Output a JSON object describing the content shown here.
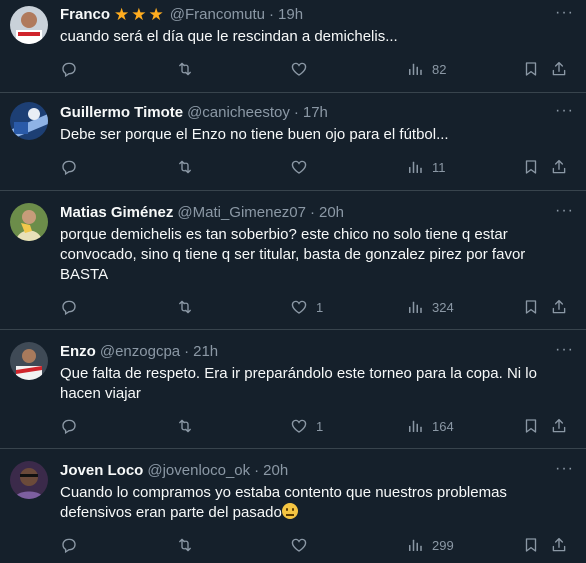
{
  "tweets": [
    {
      "name": "Franco",
      "stars": [
        "★",
        "★",
        "★"
      ],
      "handle": "@Francomutu",
      "dot": "·",
      "time": "19h",
      "text": "cuando será el día que le rescindan a demichelis...",
      "replies": "",
      "retweets": "",
      "likes": "",
      "views": "82",
      "more": "···"
    },
    {
      "name": "Guillermo Timote",
      "handle": "@canicheestoy",
      "dot": "·",
      "time": "17h",
      "text": "Debe ser porque el Enzo no tiene buen ojo para el fútbol...",
      "replies": "",
      "retweets": "",
      "likes": "",
      "views": "11",
      "more": "···"
    },
    {
      "name": "Matias Giménez",
      "handle": "@Mati_Gimenez07",
      "dot": "·",
      "time": "20h",
      "text": "porque demichelis es tan soberbio? este chico no solo tiene q estar convocado, sino q tiene q ser titular, basta de gonzalez pirez por favor BASTA",
      "replies": "",
      "retweets": "",
      "likes": "1",
      "views": "324",
      "more": "···"
    },
    {
      "name": "Enzo",
      "handle": "@enzogcpa",
      "dot": "·",
      "time": "21h",
      "text": "Que falta de respeto. Era ir preparándolo este torneo para la copa. Ni lo hacen viajar",
      "replies": "",
      "retweets": "",
      "likes": "1",
      "views": "164",
      "more": "···"
    },
    {
      "name": "Joven Loco",
      "handle": "@jovenloco_ok",
      "dot": "·",
      "time": "20h",
      "text": "Cuando lo compramos yo estaba contento que nuestros problemas defensivos eran parte del pasado",
      "emoji": "neutral-face-emoji",
      "replies": "",
      "retweets": "",
      "likes": "",
      "views": "299",
      "more": "···"
    }
  ],
  "colors": {
    "background": "#15202b",
    "divider": "#38444d",
    "secondary_text": "#8b98a5",
    "primary_text": "#f7f9f9",
    "star": "#ffad1f"
  },
  "icons": [
    "reply-icon",
    "retweet-icon",
    "like-icon",
    "views-icon",
    "bookmark-icon",
    "share-icon",
    "more-icon",
    "star-icon"
  ]
}
